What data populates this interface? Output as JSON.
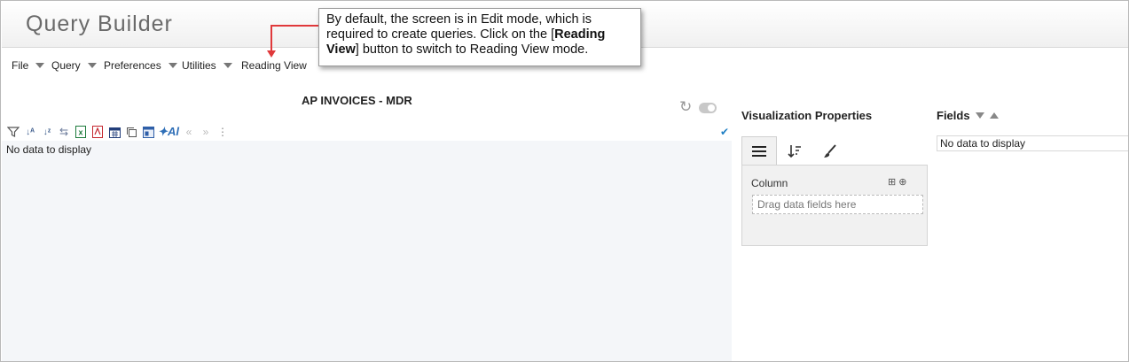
{
  "app": {
    "title": "Query Builder"
  },
  "menu": [
    {
      "label": "File",
      "has_caret": true
    },
    {
      "label": "Query",
      "has_caret": true
    },
    {
      "label": "Preferences",
      "has_caret": true
    },
    {
      "label": "Utilities",
      "has_caret": true
    },
    {
      "label": "Reading View",
      "has_caret": false
    }
  ],
  "callout": {
    "part1": "By default, the screen is in Edit mode, which is required to create queries. Click on the [",
    "bold": "Reading View",
    "part2": "] button to switch to Reading View mode."
  },
  "grid": {
    "title": "AP INVOICES - MDR",
    "empty_text": "No data to display",
    "toolbar_icons": [
      "filter-icon",
      "sort-asc-icon",
      "sort-desc-icon",
      "swap-icon",
      "excel-icon",
      "pdf-icon",
      "calendar-icon",
      "copy-icon",
      "window-icon",
      "ai-icon",
      "prev-icon",
      "next-icon",
      "more-icon"
    ]
  },
  "visualization": {
    "title": "Visualization Properties",
    "tabs": [
      "list-icon",
      "sort-icon",
      "brush-icon"
    ],
    "column_label": "Column",
    "drop_placeholder": "Drag data fields here"
  },
  "fields": {
    "title": "Fields",
    "empty_text": "No data to display"
  }
}
